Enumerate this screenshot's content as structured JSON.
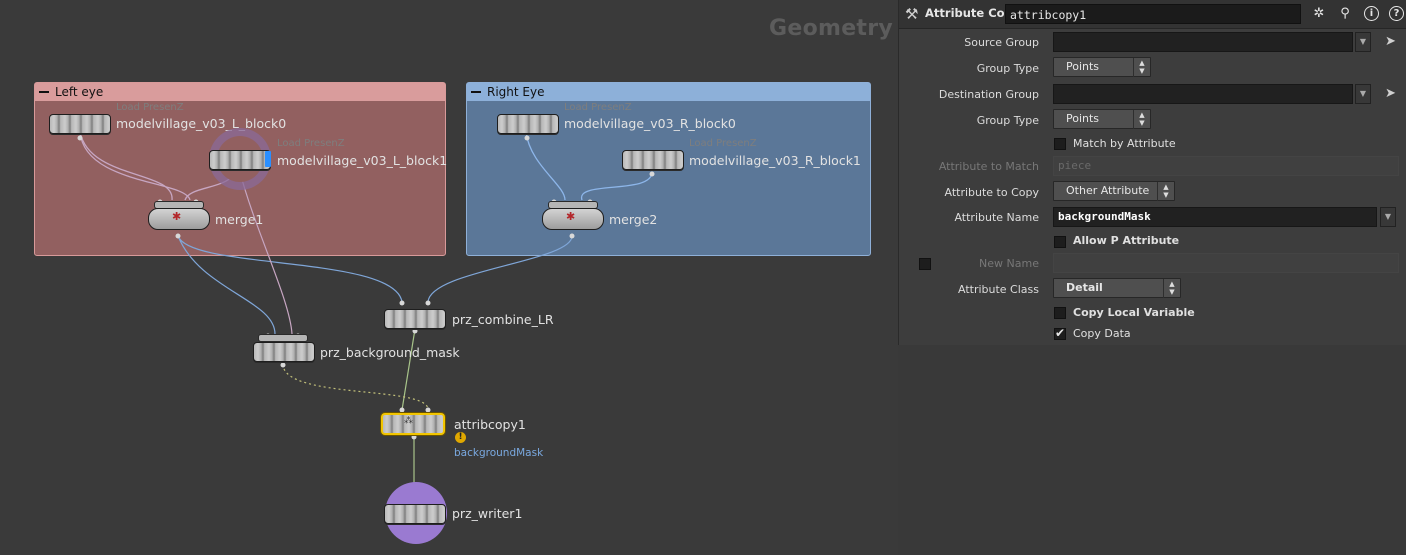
{
  "network": {
    "context_label": "Geometry",
    "boxes": {
      "left": {
        "title": "Left eye"
      },
      "right": {
        "title": "Right Eye"
      }
    },
    "nodes": {
      "l_block0": {
        "name": "modelvillage_v03_L_block0",
        "type_label": "Load PresenZ"
      },
      "l_block1": {
        "name": "modelvillage_v03_L_block1",
        "type_label": "Load PresenZ"
      },
      "merge1": {
        "name": "merge1"
      },
      "r_block0": {
        "name": "modelvillage_v03_R_block0",
        "type_label": "Load PresenZ"
      },
      "r_block1": {
        "name": "modelvillage_v03_R_block1",
        "type_label": "Load PresenZ"
      },
      "merge2": {
        "name": "merge2"
      },
      "combine": {
        "name": "prz_combine_LR"
      },
      "bgmask": {
        "name": "prz_background_mask"
      },
      "attribcopy": {
        "name": "attribcopy1",
        "comment": "backgroundMask",
        "warning": "!"
      },
      "writer": {
        "name": "prz_writer1"
      }
    },
    "colors": {
      "left_box": "#926060",
      "right_box": "#5b7798",
      "selection": "#f2c500",
      "wire_blue": "#7fa6d8",
      "wire_green": "#a8c48a",
      "writer_circle": "#9a7ad1"
    }
  },
  "params": {
    "header": {
      "op_type": "Attribute Copy",
      "op_name": "attribcopy1",
      "icons": [
        "gear-icon",
        "search-icon",
        "info-icon",
        "help-icon"
      ]
    },
    "source_group": {
      "label": "Source Group",
      "value": ""
    },
    "group_type_1": {
      "label": "Group Type",
      "value": "Points"
    },
    "destination_group": {
      "label": "Destination Group",
      "value": ""
    },
    "group_type_2": {
      "label": "Group Type",
      "value": "Points"
    },
    "match_by_attribute": {
      "label": "Match by Attribute",
      "checked": false
    },
    "attribute_to_match": {
      "label": "Attribute to Match",
      "value": "piece"
    },
    "attribute_to_copy": {
      "label": "Attribute to Copy",
      "value": "Other Attribute"
    },
    "attribute_name": {
      "label": "Attribute Name",
      "value": "backgroundMask"
    },
    "allow_p": {
      "label": "Allow P Attribute",
      "checked": false
    },
    "new_name": {
      "label": "New Name",
      "value": ""
    },
    "attribute_class": {
      "label": "Attribute Class",
      "value": "Detail"
    },
    "copy_local_variable": {
      "label": "Copy Local Variable",
      "checked": false
    },
    "copy_data": {
      "label": "Copy Data",
      "checked": true
    }
  }
}
